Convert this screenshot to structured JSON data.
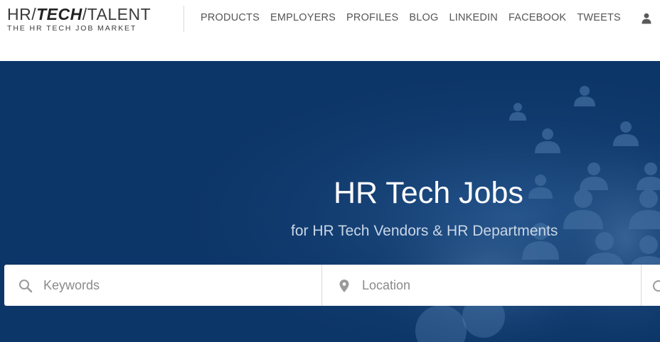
{
  "logo": {
    "part1": "HR/",
    "part2": "TECH",
    "part3": "/TALENT",
    "tagline": "THE HR TECH JOB MARKET"
  },
  "nav": {
    "items": [
      "PRODUCTS",
      "EMPLOYERS",
      "PROFILES",
      "BLOG",
      "LINKEDIN",
      "FACEBOOK",
      "TWEETS"
    ]
  },
  "hero": {
    "title": "HR Tech Jobs",
    "subtitle": "for HR Tech Vendors & HR Departments"
  },
  "search": {
    "keywords_placeholder": "Keywords",
    "location_placeholder": "Location"
  },
  "icons": {
    "user": "user-icon",
    "search": "search-icon",
    "location": "map-pin-icon"
  },
  "colors": {
    "hero_background": "#0d3668",
    "nav_text": "#555555",
    "hero_title": "#ffffff",
    "hero_subtitle": "#c9d6e6"
  }
}
